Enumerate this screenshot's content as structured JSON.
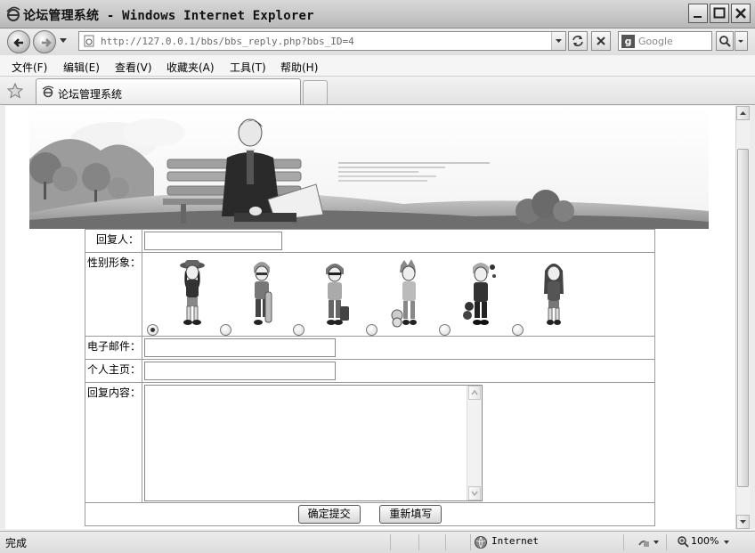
{
  "window": {
    "title": "论坛管理系统 - Windows Internet Explorer"
  },
  "address_bar": {
    "url": "http://127.0.0.1/bbs/bbs_reply.php?bbs_ID=4",
    "search_placeholder": "Google"
  },
  "menu": {
    "items": [
      {
        "label": "文件(F)"
      },
      {
        "label": "编辑(E)"
      },
      {
        "label": "查看(V)"
      },
      {
        "label": "收藏夹(A)"
      },
      {
        "label": "工具(T)"
      },
      {
        "label": "帮助(H)"
      }
    ]
  },
  "tab": {
    "label": "论坛管理系统"
  },
  "form": {
    "replier_label": "回复人：",
    "replier_value": "",
    "avatar_label": "性别形象：",
    "avatars": [
      {
        "name": "girl-hat",
        "selected": true
      },
      {
        "name": "boy-skateboard",
        "selected": false
      },
      {
        "name": "boy-bag",
        "selected": false
      },
      {
        "name": "boy-pet",
        "selected": false
      },
      {
        "name": "boy-roses",
        "selected": false
      },
      {
        "name": "girl-longhair",
        "selected": false
      }
    ],
    "email_label": "电子邮件：",
    "email_value": "",
    "homepage_label": "个人主页：",
    "homepage_value": "",
    "content_label": "回复内容：",
    "content_value": "",
    "submit_label": "确定提交",
    "reset_label": "重新填写"
  },
  "status_bar": {
    "status": "完成",
    "zone": "Internet",
    "zoom": "100%"
  }
}
